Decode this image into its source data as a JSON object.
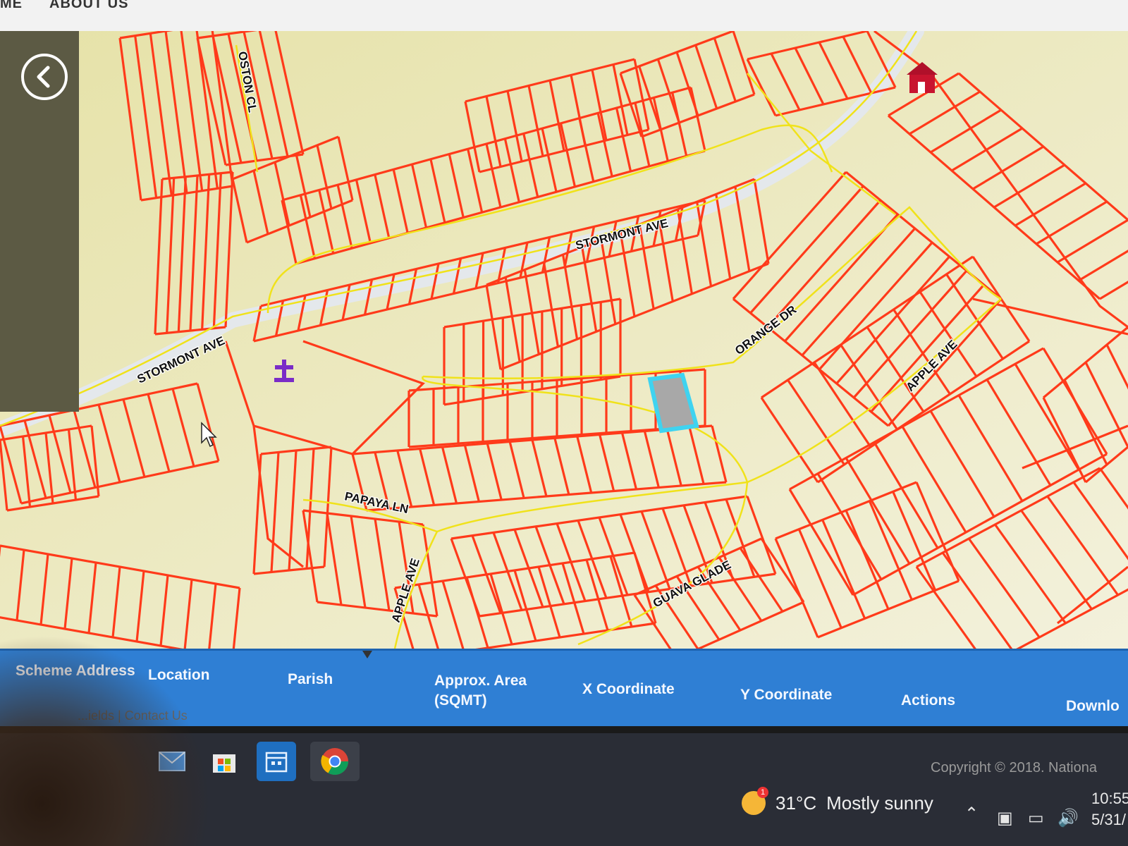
{
  "header": {
    "nav_left": "ME",
    "nav_about": "ABOUT US"
  },
  "map": {
    "streets": [
      {
        "name": "STORMONT AVE",
        "pos": "upper"
      },
      {
        "name": "STORMONT AVE",
        "pos": "lower"
      },
      {
        "name": "ORANGE DR",
        "pos": "mid"
      },
      {
        "name": "APPLE AVE",
        "pos": "right"
      },
      {
        "name": "PAPAYA LN",
        "pos": "left"
      },
      {
        "name": "APPLE AVE",
        "pos": "bottom"
      },
      {
        "name": "GUAVA GLADE",
        "pos": "bottom"
      },
      {
        "name": "OSTON CL",
        "pos": "top"
      }
    ],
    "colors": {
      "background": "#ecebc1",
      "parcel_line": "#ff3a1a",
      "road_line": "#f0e21a",
      "road_fill": "#e4e8ec",
      "selected_parcel_outline": "#3fd3f0",
      "selected_parcel_fill": "#a8a8a8",
      "church_icon": "#7a2cc7"
    },
    "icons": [
      "back-arrow-icon",
      "church-icon",
      "school-icon",
      "cursor-icon"
    ]
  },
  "table": {
    "headers": [
      "Scheme Address",
      "Location",
      "Parish",
      "Approx. Area\n(SQMT)",
      "X Coordinate",
      "Y Coordinate",
      "Actions",
      "Downlo"
    ]
  },
  "footer": {
    "links": "...ields | Contact Us",
    "copyright": "Copyright © 2018. Nationa"
  },
  "taskbar": {
    "weather_temp": "31°C",
    "weather_text": "Mostly sunny",
    "weather_badge": "1",
    "time": "10:55",
    "date": "5/31/"
  }
}
